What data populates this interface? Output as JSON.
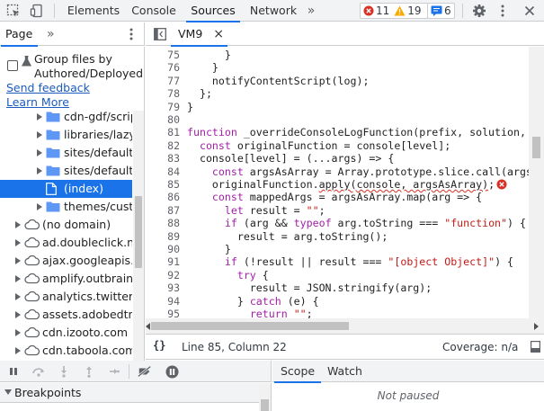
{
  "toolbar": {
    "tabs": [
      "Elements",
      "Console",
      "Sources",
      "Network"
    ],
    "active_tab": "Sources",
    "errors_count": "11",
    "warnings_count": "19",
    "messages_count": "6",
    "colors": {
      "accent": "#1a73e8",
      "error": "#d93025",
      "warning": "#e8a400",
      "message": "#1a73e8"
    }
  },
  "navigator": {
    "tab_label": "Page",
    "more_tabs_glyph": "»",
    "group_files_label": "Group files by Authored/Deployed",
    "send_feedback": "Send feedback",
    "learn_more": "Learn More",
    "tree": [
      {
        "label": "cdn-gdf/script",
        "type": "folder",
        "depth": 2,
        "expanded": false
      },
      {
        "label": "libraries/lazysi",
        "type": "folder",
        "depth": 2,
        "expanded": false
      },
      {
        "label": "sites/default/f",
        "type": "folder",
        "depth": 2,
        "expanded": false
      },
      {
        "label": "sites/default/f",
        "type": "folder",
        "depth": 2,
        "expanded": false
      },
      {
        "label": "(index)",
        "type": "file",
        "depth": 3,
        "selected": true
      },
      {
        "label": "themes/custom/",
        "type": "folder",
        "depth": 2,
        "expanded": false
      },
      {
        "label": "(no domain)",
        "type": "cloud",
        "depth": 1,
        "expanded": false
      },
      {
        "label": "ad.doubleclick.net",
        "type": "cloud",
        "depth": 1,
        "expanded": false
      },
      {
        "label": "ajax.googleapis.co",
        "type": "cloud",
        "depth": 1,
        "expanded": false
      },
      {
        "label": "amplify.outbrain.co",
        "type": "cloud",
        "depth": 1,
        "expanded": false
      },
      {
        "label": "analytics.twitter.co",
        "type": "cloud",
        "depth": 1,
        "expanded": false
      },
      {
        "label": "assets.adobedtm.c",
        "type": "cloud",
        "depth": 1,
        "expanded": false
      },
      {
        "label": "cdn.izooto.com",
        "type": "cloud",
        "depth": 1,
        "expanded": false
      },
      {
        "label": "cdn.taboola.com",
        "type": "cloud",
        "depth": 1,
        "expanded": false
      }
    ]
  },
  "editor": {
    "file_tab": "VM9",
    "close_glyph": "×",
    "line_numbers": [
      "75",
      "76",
      "77",
      "78",
      "79",
      "80",
      "81",
      "82",
      "83",
      "84",
      "85",
      "86",
      "87",
      "88",
      "89",
      "90",
      "91",
      "92",
      "93",
      "94",
      "95"
    ],
    "lines": [
      "      }",
      "    }",
      "    notifyContentScript(log);",
      "  };",
      "}",
      "",
      "function _overrideConsoleLogFunction(prefix, solution, level) {",
      "  const originalFunction = console[level];",
      "  console[level] = (...args) => {",
      "    const argsAsArray = Array.prototype.slice.call(args);",
      "    originalFunction.apply(console, argsAsArray);",
      "    const mappedArgs = argsAsArray.map(arg => {",
      "      let result = \"\";",
      "      if (arg && typeof arg.toString === \"function\") {",
      "        result = arg.toString();",
      "      }",
      "      if (!result || result === \"[object Object]\") {",
      "        try {",
      "          result = JSON.stringify(arg);",
      "        } catch (e) {",
      "          return \"\";"
    ],
    "error_line_index": 10
  },
  "status": {
    "pretty_print_glyph": "{}",
    "position": "Line 85, Column 22",
    "coverage": "Coverage: n/a"
  },
  "debugger": {
    "breakpoints_label": "Breakpoints",
    "scope_tab": "Scope",
    "watch_tab": "Watch",
    "not_paused": "Not paused"
  }
}
